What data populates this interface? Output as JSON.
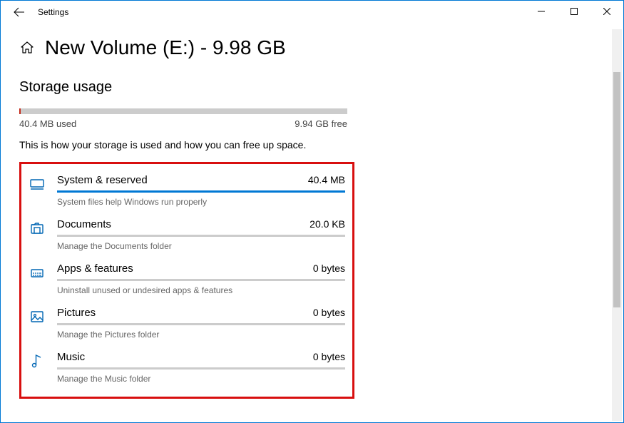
{
  "titlebar": {
    "app_name": "Settings"
  },
  "header": {
    "title": "New Volume (E:) - 9.98 GB"
  },
  "section": {
    "heading": "Storage usage",
    "used_label": "40.4 MB used",
    "free_label": "9.94 GB free",
    "description": "This is how your storage is used and how you can free up space."
  },
  "categories": [
    {
      "icon": "system",
      "name": "System & reserved",
      "size": "40.4 MB",
      "desc": "System files help Windows run properly",
      "fill_percent": 100
    },
    {
      "icon": "documents",
      "name": "Documents",
      "size": "20.0 KB",
      "desc": "Manage the Documents folder",
      "fill_percent": 0
    },
    {
      "icon": "apps",
      "name": "Apps & features",
      "size": "0 bytes",
      "desc": "Uninstall unused or undesired apps & features",
      "fill_percent": 0
    },
    {
      "icon": "pictures",
      "name": "Pictures",
      "size": "0 bytes",
      "desc": "Manage the Pictures folder",
      "fill_percent": 0
    },
    {
      "icon": "music",
      "name": "Music",
      "size": "0 bytes",
      "desc": "Manage the Music folder",
      "fill_percent": 0
    }
  ]
}
